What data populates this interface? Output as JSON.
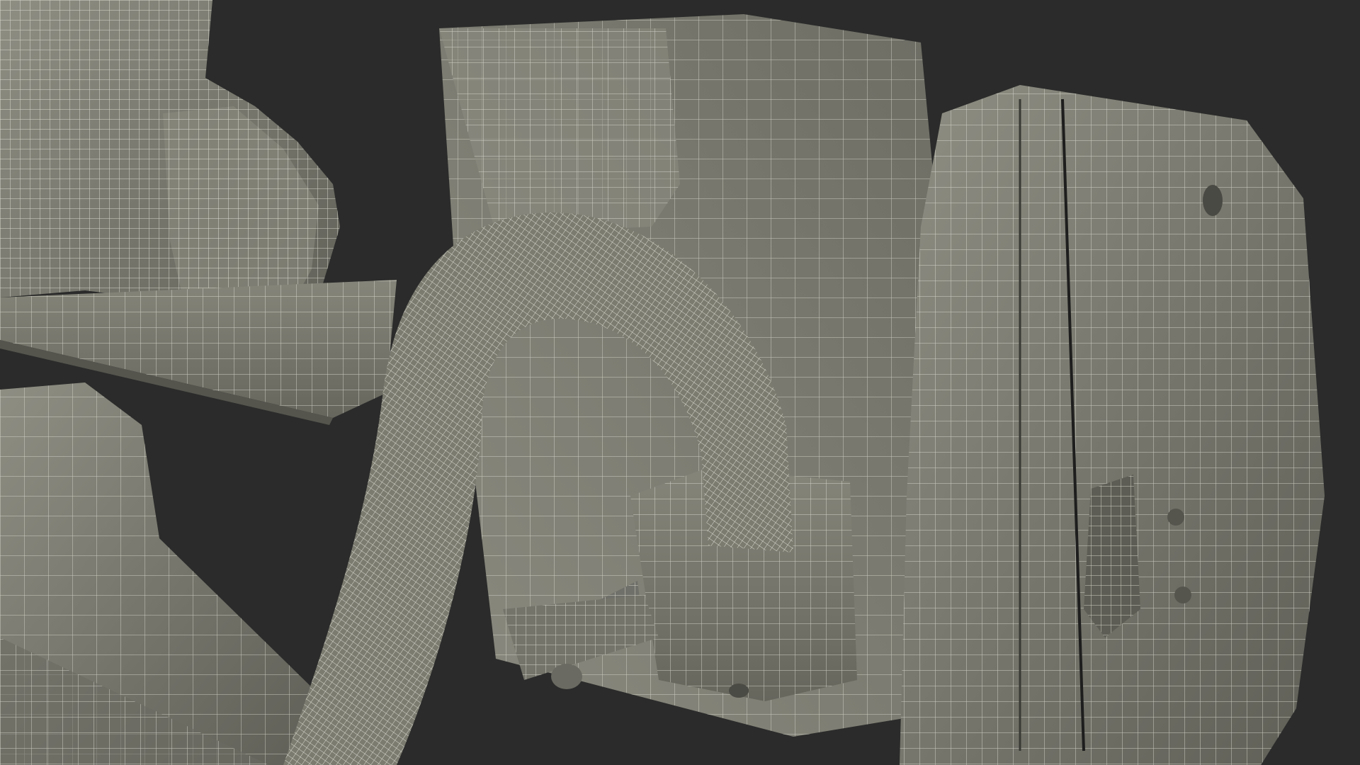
{
  "scene": {
    "background_color": "#2b2b2b",
    "surface_color": "#7f7f74",
    "surface_shadow_color": "#5e5e56",
    "surface_highlight_color": "#9a9a8e",
    "wire_color": "#e6e6dc"
  }
}
